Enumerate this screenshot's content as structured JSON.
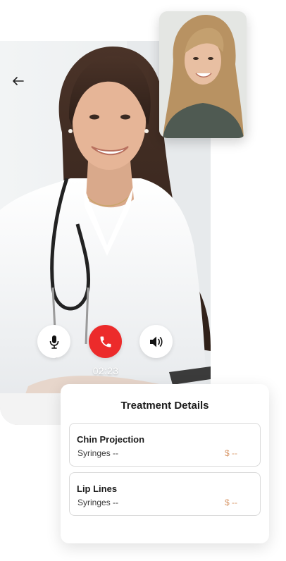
{
  "call": {
    "timer": "02:23"
  },
  "icons": {
    "back": "arrow-left-icon",
    "mic": "microphone-icon",
    "end_call": "phone-icon",
    "speaker": "speaker-icon"
  },
  "colors": {
    "end_call": "#ec2b2b",
    "price": "#d99a6c"
  },
  "treatment": {
    "title": "Treatment Details",
    "items": [
      {
        "name": "Chin Projection",
        "syringes": "Syringes --",
        "price": "$ --"
      },
      {
        "name": "Lip Lines",
        "syringes": "Syringes --",
        "price": "$ --"
      }
    ]
  }
}
